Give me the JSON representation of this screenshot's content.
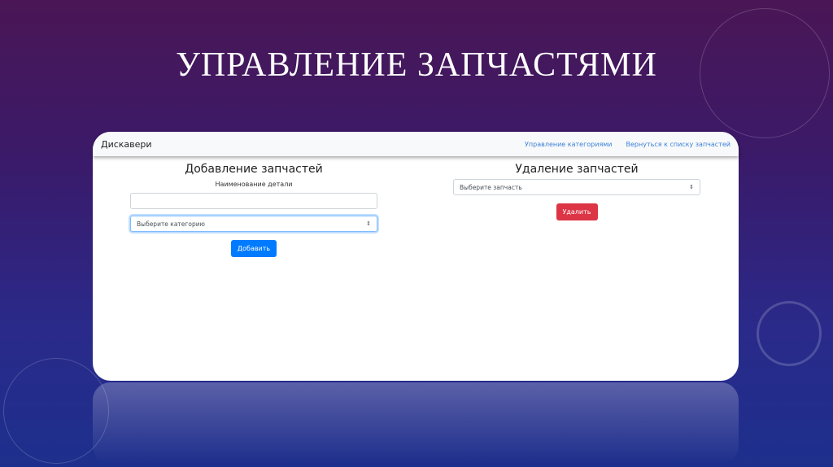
{
  "slide": {
    "title": "УПРАВЛЕНИЕ ЗАПЧАСТЯМИ"
  },
  "navbar": {
    "brand": "Дискавери",
    "links": [
      "Управление категориями",
      "Вернуться к списку запчастей"
    ]
  },
  "add_section": {
    "heading": "Добавление запчастей",
    "name_label": "Наименование детали",
    "name_value": "",
    "category_select": "Выберите категорию",
    "button": "Добавить"
  },
  "delete_section": {
    "heading": "Удаление запчастей",
    "part_select": "Выберите запчасть",
    "button": "Удалить"
  },
  "colors": {
    "primary": "#007bff",
    "danger": "#dc3545",
    "link": "#3b82d9"
  }
}
